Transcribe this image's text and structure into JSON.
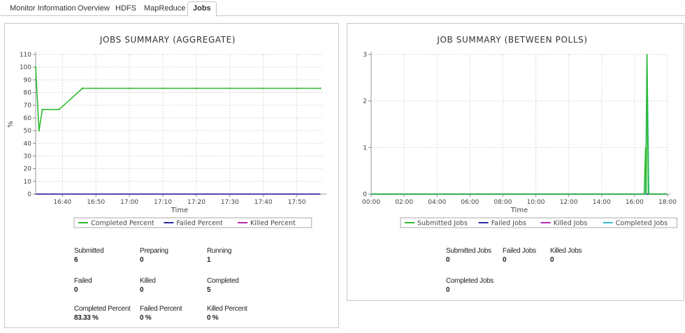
{
  "tabs": [
    {
      "label": "Monitor Information",
      "active": false
    },
    {
      "label": "Overview",
      "active": false
    },
    {
      "label": "HDFS",
      "active": false
    },
    {
      "label": "MapReduce",
      "active": false
    },
    {
      "label": "Jobs",
      "active": true
    }
  ],
  "left_panel": {
    "stats": [
      {
        "label": "Submitted",
        "value": "6"
      },
      {
        "label": "Preparing",
        "value": "0"
      },
      {
        "label": "Running",
        "value": "1"
      },
      {
        "label": "Failed",
        "value": "0"
      },
      {
        "label": "Killed",
        "value": "0"
      },
      {
        "label": "Completed",
        "value": "5"
      },
      {
        "label": "Completed Percent",
        "value": "83.33 %"
      },
      {
        "label": "Failed Percent",
        "value": "0 %"
      },
      {
        "label": "Killed Percent",
        "value": "0 %"
      }
    ]
  },
  "right_panel": {
    "stats": [
      {
        "label": "Submitted Jobs",
        "value": "0"
      },
      {
        "label": "Failed Jobs",
        "value": "0"
      },
      {
        "label": "Killed Jobs",
        "value": "0"
      },
      {
        "label": "Completed Jobs",
        "value": "0"
      }
    ]
  },
  "chart_data": [
    {
      "type": "line",
      "title": "JOBS SUMMARY (AGGREGATE)",
      "xlabel": "Time",
      "ylabel": "%",
      "ylim": [
        0,
        110
      ],
      "yticks": [
        0,
        10,
        20,
        30,
        40,
        50,
        60,
        70,
        80,
        90,
        100,
        110
      ],
      "xlim": [
        "16:32",
        "17:58"
      ],
      "xticks": [
        "16:40",
        "16:50",
        "17:00",
        "17:10",
        "17:20",
        "17:30",
        "17:40",
        "17:50"
      ],
      "grid": true,
      "legend_position": "bottom",
      "series": [
        {
          "name": "Completed Percent",
          "color": "#2dbb2d",
          "x": [
            "16:32",
            "16:33",
            "16:34",
            "16:39",
            "16:46",
            "16:50",
            "17:00",
            "17:10",
            "17:20",
            "17:30",
            "17:40",
            "17:50",
            "17:57"
          ],
          "values": [
            100,
            50,
            66.67,
            66.67,
            83.33,
            83.33,
            83.33,
            83.33,
            83.33,
            83.33,
            83.33,
            83.33,
            83.33
          ]
        },
        {
          "name": "Failed Percent",
          "color": "#2b2ba8",
          "x": [
            "16:32",
            "17:57"
          ],
          "values": [
            0,
            0
          ]
        },
        {
          "name": "Killed Percent",
          "color": "#b02ab0",
          "x": [
            "16:32",
            "17:57"
          ],
          "values": [
            0,
            0
          ]
        }
      ]
    },
    {
      "type": "line",
      "title": "JOB SUMMARY (BETWEEN POLLS)",
      "xlabel": "Time",
      "ylabel": "",
      "ylim": [
        0,
        3
      ],
      "yticks": [
        0,
        1,
        2,
        3
      ],
      "xlim": [
        "00:00",
        "18:00"
      ],
      "xticks": [
        "00:00",
        "02:00",
        "04:00",
        "06:00",
        "08:00",
        "10:00",
        "12:00",
        "14:00",
        "16:00",
        "18:00"
      ],
      "grid": true,
      "legend_position": "bottom",
      "series": [
        {
          "name": "Submitted Jobs",
          "color": "#2dbb2d",
          "x": [
            "00:00",
            "16:35",
            "16:40",
            "16:42",
            "16:45",
            "16:50",
            "16:53",
            "17:58"
          ],
          "values": [
            0,
            0,
            1,
            0,
            3,
            0,
            0,
            0
          ]
        },
        {
          "name": "Failed Jobs",
          "color": "#2b2ba8",
          "x": [
            "00:00",
            "17:58"
          ],
          "values": [
            0,
            0
          ]
        },
        {
          "name": "Killed Jobs",
          "color": "#b02ab0",
          "x": [
            "00:00",
            "17:58"
          ],
          "values": [
            0,
            0
          ]
        },
        {
          "name": "Completed Jobs",
          "color": "#33bbcc",
          "x": [
            "00:00",
            "16:40",
            "16:45",
            "16:52",
            "16:55",
            "17:58"
          ],
          "values": [
            0,
            0,
            3,
            0,
            0,
            0
          ]
        }
      ]
    }
  ]
}
